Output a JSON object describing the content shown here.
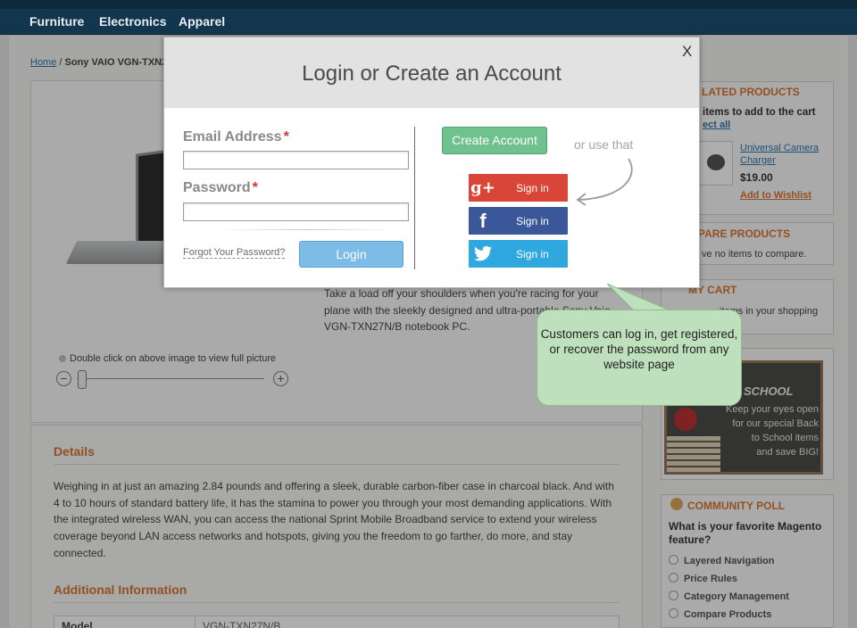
{
  "nav": {
    "items": [
      "Furniture",
      "Electronics",
      "Apparel"
    ]
  },
  "breadcrumb": {
    "home": "Home",
    "separator": " / ",
    "current": "Sony VAIO VGN-TXN2"
  },
  "product": {
    "description": "Take a load off your shoulders when you're racing for your plane with the sleekly designed and ultra-portable Sony Vaio VGN-TXN27N/B notebook PC.",
    "zoom_note": "Double click on above image to view full picture",
    "zoom_minus": "−",
    "zoom_plus": "+",
    "details_title": "Details",
    "details_text": "Weighing in at just an amazing 2.84 pounds and offering a sleek, durable carbon-fiber case in charcoal black. And with 4 to 10 hours of standard battery life, it has the stamina to power you through your most demanding applications. With the integrated wireless WAN, you can access the national Sprint Mobile Broadband service to extend your wireless coverage beyond LAN access networks and hotspots, giving you the freedom to go farther, do more, and stay connected.",
    "additional_title": "Additional Information",
    "spec_key": "Model",
    "spec_value": "VGN-TXN27N/B"
  },
  "sidebar": {
    "related_title": "LATED PRODUCTS",
    "related_hint": "items to add to the cart",
    "related_select_all": "ect all",
    "related_item_name": "Universal Camera Charger",
    "related_item_price": "$19.00",
    "related_wishlist": "Add to Wishlist",
    "compare_title": "MPARE PRODUCTS",
    "compare_text": "ve no items to compare.",
    "cart_title": "MY CART",
    "cart_text": "items in your shopping",
    "promo_title": "SCHOOL",
    "promo_text_1": "Keep your eyes open",
    "promo_text_2": "for our special Back",
    "promo_text_3": "to School items",
    "promo_text_4": "and save BIG!",
    "poll_title": "COMMUNITY POLL",
    "poll_question": "What is your favorite Magento feature?",
    "poll_options": [
      "Layered Navigation",
      "Price Rules",
      "Category Management",
      "Compare Products"
    ]
  },
  "modal": {
    "title": "Login or Create an Account",
    "close": "X",
    "email_label": "Email Address",
    "password_label": "Password",
    "required_mark": "*",
    "email_value": "",
    "password_value": "",
    "forgot": "Forgot Your Password?",
    "login": "Login",
    "create_account": "Create Account",
    "or_use": "or use that",
    "google_icon": "g+",
    "google_label": "Sign in",
    "facebook_icon": "f",
    "facebook_label": "Sign in",
    "twitter_label": "Sign in"
  },
  "callout": {
    "text": "Customers can log in, get registered, or recover the password from any website page"
  },
  "colors": {
    "accent_orange": "#d66a1e",
    "google": "#d94536",
    "facebook": "#3a5899",
    "twitter": "#2fa7df",
    "create": "#6fc18e",
    "login": "#7cbce6",
    "callout": "#bfe0bd"
  }
}
